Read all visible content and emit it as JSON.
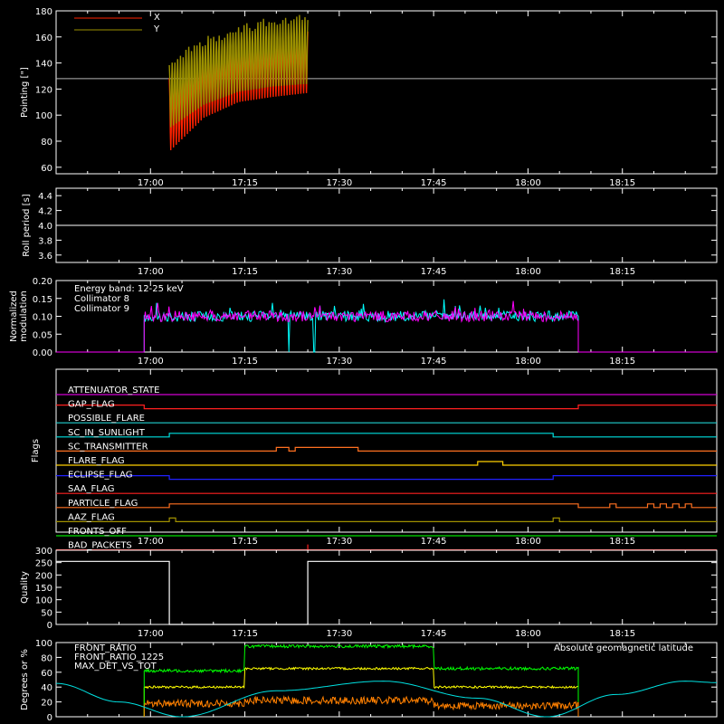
{
  "chart_data": [
    {
      "type": "line",
      "panel": "pointing",
      "ylabel": "Pointing [\"]",
      "ylim": [
        55,
        180
      ],
      "yticks": [
        60,
        80,
        100,
        120,
        140,
        160,
        180
      ],
      "xlim": [
        "16:45",
        "18:30"
      ],
      "xticks": [
        "17:00",
        "17:15",
        "17:30",
        "17:45",
        "18:00",
        "18:15"
      ],
      "series": [
        {
          "name": "X",
          "color": "#ff2200",
          "x_range": [
            "17:03",
            "17:25"
          ],
          "lower_envelope": [
            [
              0,
              72
            ],
            [
              0.25,
              98
            ],
            [
              0.5,
              110
            ],
            [
              0.75,
              114
            ],
            [
              1.0,
              117
            ]
          ],
          "upper_envelope": [
            [
              0,
              132
            ],
            [
              0.25,
              150
            ],
            [
              0.5,
              158
            ],
            [
              0.75,
              164
            ],
            [
              1.0,
              166
            ]
          ]
        },
        {
          "name": "Y",
          "color": "#9b9000",
          "x_range": [
            "17:03",
            "17:25"
          ],
          "lower_envelope": [
            [
              0,
              90
            ],
            [
              0.25,
              108
            ],
            [
              0.5,
              118
            ],
            [
              0.75,
              122
            ],
            [
              1.0,
              124
            ]
          ],
          "upper_envelope": [
            [
              0,
              146
            ],
            [
              0.25,
              160
            ],
            [
              0.5,
              170
            ],
            [
              0.75,
              176
            ],
            [
              1.0,
              178
            ]
          ]
        }
      ],
      "reference_line": {
        "y": 128,
        "color": "#b4b4b4"
      },
      "legend": "top-left"
    },
    {
      "type": "line",
      "panel": "roll_period",
      "ylabel": "Roll period [s]",
      "ylim": [
        3.5,
        4.5
      ],
      "yticks": [
        "3.6",
        "3.8",
        "4.0",
        "4.2",
        "4.4"
      ],
      "series": [
        {
          "x": [
            "16:45",
            "18:30"
          ],
          "values": [
            4.0,
            4.0
          ],
          "color": "#ffffff"
        }
      ]
    },
    {
      "type": "line",
      "panel": "modulation",
      "ylabel_line1": "Normalized",
      "ylabel_line2": "modulation",
      "ylim": [
        0,
        0.2
      ],
      "yticks": [
        "0.00",
        "0.05",
        "0.10",
        "0.15",
        "0.20"
      ],
      "annotation": "Energy band: 12-25 keV",
      "series": [
        {
          "name": "Collimator 8",
          "color": "#00ffff",
          "x_range": [
            "16:59",
            "18:08"
          ],
          "mean": 0.1,
          "gap": [
            "17:22",
            "17:26"
          ]
        },
        {
          "name": "Collimator 9",
          "color": "#ff00ff",
          "x_range": [
            "16:59",
            "18:08"
          ],
          "mean": 0.1
        }
      ]
    },
    {
      "type": "line",
      "panel": "flags",
      "ylabel": "Flags",
      "flags": [
        {
          "name": "ATTENUATOR_STATE",
          "color": "#d100d1",
          "steps": [],
          "high_ranges": []
        },
        {
          "name": "GAP_FLAG",
          "color": "#ff2020",
          "high_ranges": [
            [
              "16:45",
              "16:59"
            ],
            [
              "18:08",
              "18:30"
            ]
          ]
        },
        {
          "name": "POSSIBLE_FLARE",
          "color": "#20d0d0",
          "high_ranges": []
        },
        {
          "name": "SC_IN_SUNLIGHT",
          "color": "#00e0e0",
          "high_ranges": [
            [
              "17:03",
              "18:04"
            ]
          ]
        },
        {
          "name": "SC_TRANSMITTER",
          "color": "#ff7020",
          "high_ranges": [
            [
              "17:20",
              "17:22"
            ],
            [
              "17:23",
              "17:33"
            ]
          ]
        },
        {
          "name": "FLARE_FLAG",
          "color": "#ffd000",
          "high_ranges": [
            [
              "17:52",
              "17:56"
            ]
          ]
        },
        {
          "name": "ECLIPSE_FLAG",
          "color": "#2020ff",
          "high_ranges": [
            [
              "16:45",
              "17:03"
            ],
            [
              "18:04",
              "18:30"
            ]
          ]
        },
        {
          "name": "SAA_FLAG",
          "color": "#ff2020",
          "high_ranges": []
        },
        {
          "name": "PARTICLE_FLAG",
          "color": "#ff7020",
          "high_ranges": [
            [
              "17:03",
              "18:08"
            ],
            [
              "18:13",
              "18:14"
            ],
            [
              "18:19",
              "18:20"
            ],
            [
              "18:21",
              "18:22"
            ],
            [
              "18:23",
              "18:24"
            ],
            [
              "18:25",
              "18:26"
            ]
          ]
        },
        {
          "name": "AAZ_FLAG",
          "color": "#a09000",
          "high_ranges": [
            [
              "17:03",
              "17:04"
            ],
            [
              "18:04",
              "18:05"
            ]
          ]
        },
        {
          "name": "FRONTS_OFF",
          "color": "#00e000",
          "high_ranges": []
        },
        {
          "name": "BAD_PACKETS",
          "color": "#ff2020",
          "high_ranges": [
            [
              "17:25",
              "17:25"
            ]
          ]
        }
      ]
    },
    {
      "type": "line",
      "panel": "quality",
      "ylabel": "Quality",
      "ylim": [
        0,
        300
      ],
      "yticks": [
        0,
        50,
        100,
        150,
        200,
        250,
        300
      ],
      "series": [
        {
          "color": "#ffffff",
          "segments": [
            {
              "x": [
                "16:45",
                "17:03"
              ],
              "value": 255
            },
            {
              "x": [
                "17:03",
                "17:25"
              ],
              "value": 0
            },
            {
              "x": [
                "17:25",
                "18:30"
              ],
              "value": 255
            }
          ]
        }
      ]
    },
    {
      "type": "line",
      "panel": "geo",
      "ylabel": "Degrees or %",
      "ylim": [
        0,
        100
      ],
      "yticks": [
        0,
        20,
        40,
        60,
        80,
        100
      ],
      "series": [
        {
          "name": "FRONT_RATIO",
          "color": "#ffff00",
          "x_range": [
            "16:59",
            "18:08"
          ],
          "levels": [
            {
              "x": [
                "16:59",
                "17:15"
              ],
              "y": 40
            },
            {
              "x": [
                "17:15",
                "17:45"
              ],
              "y": 65
            },
            {
              "x": [
                "17:45",
                "18:08"
              ],
              "y": 40
            }
          ]
        },
        {
          "name": "FRONT_RATIO_1225",
          "color": "#00ff00",
          "x_range": [
            "16:59",
            "18:08"
          ],
          "levels": [
            {
              "x": [
                "16:59",
                "17:15"
              ],
              "y": 62
            },
            {
              "x": [
                "17:15",
                "17:45"
              ],
              "y": 95
            },
            {
              "x": [
                "17:45",
                "18:08"
              ],
              "y": 65
            }
          ]
        },
        {
          "name": "MAX_DET_VS_TOT",
          "color": "#ff8000",
          "x_range": [
            "16:59",
            "18:08"
          ],
          "levels": [
            {
              "x": [
                "16:59",
                "17:15"
              ],
              "y": 18
            },
            {
              "x": [
                "17:15",
                "17:45"
              ],
              "y": 22
            },
            {
              "x": [
                "17:45",
                "18:08"
              ],
              "y": 15
            }
          ]
        },
        {
          "name": "Absolute geomagnetic latitude",
          "color": "#00e0e0",
          "points": [
            [
              "16:45",
              45
            ],
            [
              "16:55",
              20
            ],
            [
              "17:05",
              0
            ],
            [
              "17:20",
              35
            ],
            [
              "17:37",
              48
            ],
            [
              "17:52",
              25
            ],
            [
              "18:03",
              0
            ],
            [
              "18:14",
              30
            ],
            [
              "18:25",
              48
            ],
            [
              "18:30",
              46
            ]
          ]
        }
      ]
    }
  ]
}
